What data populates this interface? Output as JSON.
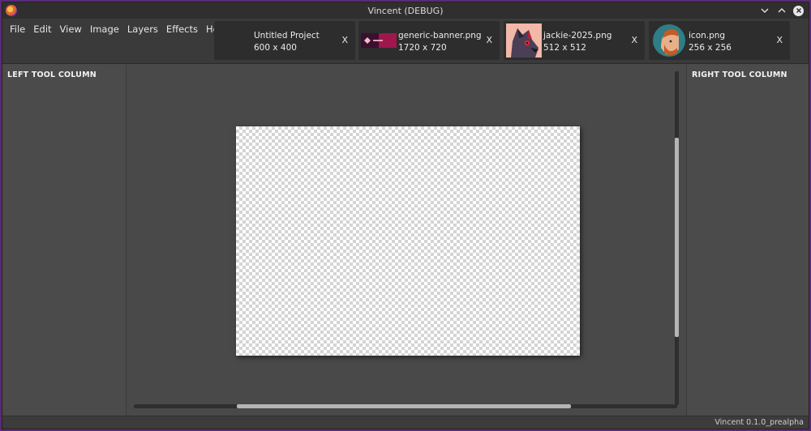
{
  "window": {
    "title": "Vincent (DEBUG)"
  },
  "menu": [
    "File",
    "Edit",
    "View",
    "Image",
    "Layers",
    "Effects",
    "Help"
  ],
  "tabs": [
    {
      "title": "Untitled Project",
      "size": "600 x 400",
      "close": "X",
      "thumbnail": "none"
    },
    {
      "title": "generic-banner.png",
      "size": "1720 x 720",
      "close": "X",
      "thumbnail": "banner-image"
    },
    {
      "title": "jackie-2025.png",
      "size": "512 x 512",
      "close": "X",
      "thumbnail": "character-portrait"
    },
    {
      "title": "icon.png",
      "size": "256 x 256",
      "close": "X",
      "thumbnail": "avatar-icon"
    }
  ],
  "left_column": {
    "title": "LEFT TOOL COLUMN"
  },
  "right_column": {
    "title": "RIGHT TOOL COLUMN"
  },
  "status": {
    "version": "Vincent 0.1.0_prealpha"
  },
  "colors": {
    "window_bg": "#4a4a4a",
    "titlebar_bg": "#2f2f2f",
    "tab_bg": "#2d2d2d",
    "desktop_bg": "#5b2a7a"
  }
}
